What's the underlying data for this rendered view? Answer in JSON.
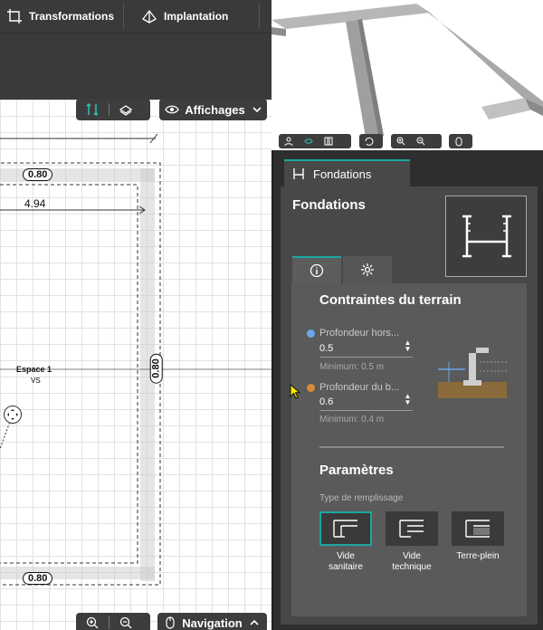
{
  "toolbar": {
    "transformations_label": "Transformations",
    "implantation_label": "Implantation"
  },
  "view_controls": {
    "affichages_label": "Affichages",
    "navigation_label": "Navigation"
  },
  "plan": {
    "dim_top": "0.80",
    "dim_bottom": "0.80",
    "dim_right": "0.80",
    "width_dim": "4.94",
    "room_name": "Espace 1",
    "room_code": "VS"
  },
  "panel": {
    "tab_label": "Fondations",
    "title": "Fondations",
    "section_constraints": "Contraintes du terrain",
    "field1_label": "Profondeur hors...",
    "field1_value": "0.5",
    "field1_hint": "Minimum: 0.5 m",
    "field1_color": "#6aa6e8",
    "field2_label": "Profondeur du b...",
    "field2_value": "0.6",
    "field2_hint": "Minimum: 0.4 m",
    "field2_color": "#d88a3a",
    "section_params": "Paramètres",
    "fill_type_label": "Type de remplissage",
    "fill_options": [
      {
        "line1": "Vide",
        "line2": "sanitaire",
        "selected": true
      },
      {
        "line1": "Vide",
        "line2": "technique",
        "selected": false
      },
      {
        "line1": "Terre-plein",
        "line2": "",
        "selected": false
      }
    ]
  },
  "colors": {
    "accent": "#1aa7a0",
    "panel_bg": "#484848",
    "toolbar_bg": "#3a3a3a"
  }
}
